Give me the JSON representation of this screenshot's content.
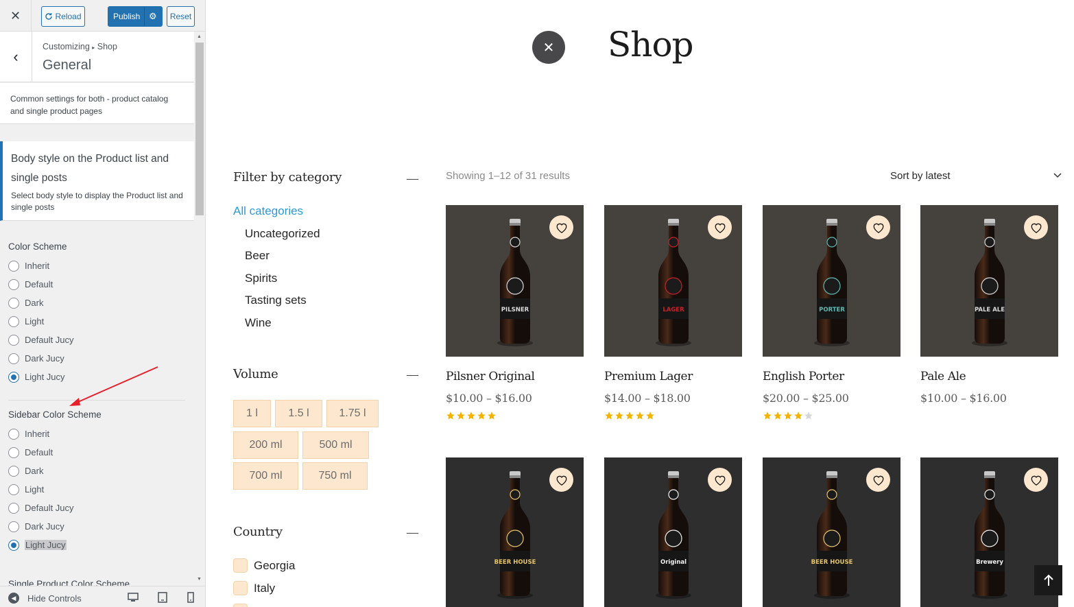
{
  "customizer": {
    "close_label": "✕",
    "reload_label": "Reload",
    "publish_label": "Publish",
    "reset_label": "Reset",
    "breadcrumb_a": "Customizing",
    "breadcrumb_b": "Shop",
    "section_title": "General",
    "section_desc": "Common settings for both - product catalog and single product pages",
    "body_style_title": "Body style on the Product list and single posts",
    "body_style_desc": "Select body style to display the Product list and single posts",
    "color_scheme": {
      "title": "Color Scheme",
      "options": [
        "Inherit",
        "Default",
        "Dark",
        "Light",
        "Default Jucy",
        "Dark Jucy",
        "Light Jucy"
      ],
      "selected": "Light Jucy"
    },
    "sidebar_color_scheme": {
      "title": "Sidebar Color Scheme",
      "options": [
        "Inherit",
        "Default",
        "Dark",
        "Light",
        "Default Jucy",
        "Dark Jucy",
        "Light Jucy"
      ],
      "selected": "Light Jucy"
    },
    "single_product_scheme_title": "Single Product Color Scheme",
    "hide_controls_label": "Hide Controls",
    "annotation_color": "#e8202a"
  },
  "shop": {
    "title": "Shop",
    "filters": {
      "category_title": "Filter by category",
      "categories": [
        "All categories",
        "Uncategorized",
        "Beer",
        "Spirits",
        "Tasting sets",
        "Wine"
      ],
      "volume_title": "Volume",
      "volumes": [
        "1 l",
        "1.5 l",
        "1.75 l",
        "200 ml",
        "500 ml",
        "700 ml",
        "750 ml"
      ],
      "country_title": "Country",
      "countries": [
        "Georgia",
        "Italy"
      ]
    },
    "result_count": "Showing 1–12 of 31 results",
    "sort_label": "Sort by latest",
    "products": [
      {
        "name": "Pilsner Original",
        "price": "$10.00 – $16.00",
        "rating": 5,
        "label": "PILSNER",
        "label_color": "#d9d9d9"
      },
      {
        "name": "Premium Lager",
        "price": "$14.00 – $18.00",
        "rating": 5,
        "label": "LAGER",
        "label_color": "#c8202a"
      },
      {
        "name": "English Porter",
        "price": "$20.00 – $25.00",
        "rating": 4,
        "label": "PORTER",
        "label_color": "#5fb8b0"
      },
      {
        "name": "Pale Ale",
        "price": "$10.00 – $16.00",
        "rating": 0,
        "label": "PALE ALE",
        "label_color": "#d9d9d9"
      },
      {
        "name": "",
        "price": "",
        "rating": 0,
        "label": "BEER HOUSE",
        "label_color": "#e7c46a"
      },
      {
        "name": "",
        "price": "",
        "rating": 0,
        "label": "Original",
        "label_color": "#f2f2f2"
      },
      {
        "name": "",
        "price": "",
        "rating": 0,
        "label": "BEER HOUSE",
        "label_color": "#e7c46a"
      },
      {
        "name": "",
        "price": "",
        "rating": 0,
        "label": "Brewery",
        "label_color": "#f2f2f2"
      }
    ],
    "accent_color": "#2a9ad8",
    "star_color": "#f5b301"
  }
}
